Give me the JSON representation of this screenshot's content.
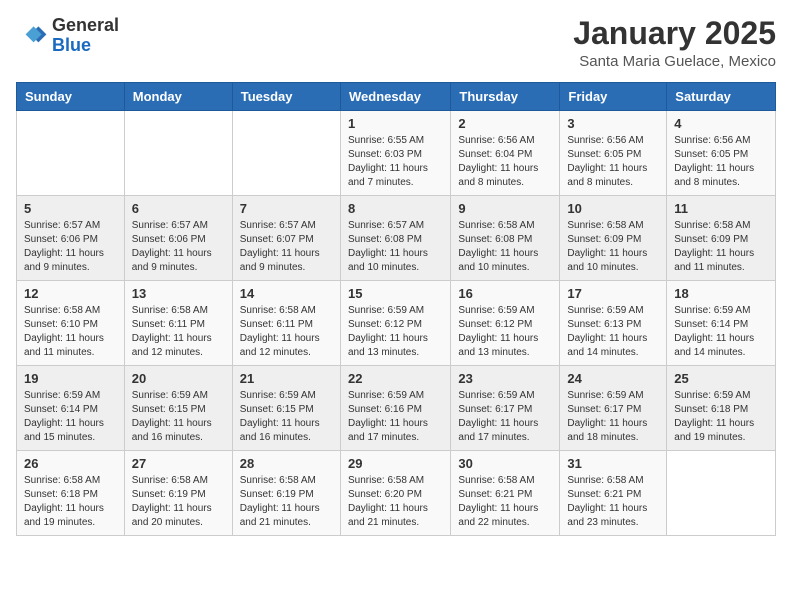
{
  "logo": {
    "general": "General",
    "blue": "Blue"
  },
  "header": {
    "title": "January 2025",
    "subtitle": "Santa Maria Guelace, Mexico"
  },
  "days_of_week": [
    "Sunday",
    "Monday",
    "Tuesday",
    "Wednesday",
    "Thursday",
    "Friday",
    "Saturday"
  ],
  "weeks": [
    [
      {
        "day": "",
        "info": ""
      },
      {
        "day": "",
        "info": ""
      },
      {
        "day": "",
        "info": ""
      },
      {
        "day": "1",
        "info": "Sunrise: 6:55 AM\nSunset: 6:03 PM\nDaylight: 11 hours and 7 minutes."
      },
      {
        "day": "2",
        "info": "Sunrise: 6:56 AM\nSunset: 6:04 PM\nDaylight: 11 hours and 8 minutes."
      },
      {
        "day": "3",
        "info": "Sunrise: 6:56 AM\nSunset: 6:05 PM\nDaylight: 11 hours and 8 minutes."
      },
      {
        "day": "4",
        "info": "Sunrise: 6:56 AM\nSunset: 6:05 PM\nDaylight: 11 hours and 8 minutes."
      }
    ],
    [
      {
        "day": "5",
        "info": "Sunrise: 6:57 AM\nSunset: 6:06 PM\nDaylight: 11 hours and 9 minutes."
      },
      {
        "day": "6",
        "info": "Sunrise: 6:57 AM\nSunset: 6:06 PM\nDaylight: 11 hours and 9 minutes."
      },
      {
        "day": "7",
        "info": "Sunrise: 6:57 AM\nSunset: 6:07 PM\nDaylight: 11 hours and 9 minutes."
      },
      {
        "day": "8",
        "info": "Sunrise: 6:57 AM\nSunset: 6:08 PM\nDaylight: 11 hours and 10 minutes."
      },
      {
        "day": "9",
        "info": "Sunrise: 6:58 AM\nSunset: 6:08 PM\nDaylight: 11 hours and 10 minutes."
      },
      {
        "day": "10",
        "info": "Sunrise: 6:58 AM\nSunset: 6:09 PM\nDaylight: 11 hours and 10 minutes."
      },
      {
        "day": "11",
        "info": "Sunrise: 6:58 AM\nSunset: 6:09 PM\nDaylight: 11 hours and 11 minutes."
      }
    ],
    [
      {
        "day": "12",
        "info": "Sunrise: 6:58 AM\nSunset: 6:10 PM\nDaylight: 11 hours and 11 minutes."
      },
      {
        "day": "13",
        "info": "Sunrise: 6:58 AM\nSunset: 6:11 PM\nDaylight: 11 hours and 12 minutes."
      },
      {
        "day": "14",
        "info": "Sunrise: 6:58 AM\nSunset: 6:11 PM\nDaylight: 11 hours and 12 minutes."
      },
      {
        "day": "15",
        "info": "Sunrise: 6:59 AM\nSunset: 6:12 PM\nDaylight: 11 hours and 13 minutes."
      },
      {
        "day": "16",
        "info": "Sunrise: 6:59 AM\nSunset: 6:12 PM\nDaylight: 11 hours and 13 minutes."
      },
      {
        "day": "17",
        "info": "Sunrise: 6:59 AM\nSunset: 6:13 PM\nDaylight: 11 hours and 14 minutes."
      },
      {
        "day": "18",
        "info": "Sunrise: 6:59 AM\nSunset: 6:14 PM\nDaylight: 11 hours and 14 minutes."
      }
    ],
    [
      {
        "day": "19",
        "info": "Sunrise: 6:59 AM\nSunset: 6:14 PM\nDaylight: 11 hours and 15 minutes."
      },
      {
        "day": "20",
        "info": "Sunrise: 6:59 AM\nSunset: 6:15 PM\nDaylight: 11 hours and 16 minutes."
      },
      {
        "day": "21",
        "info": "Sunrise: 6:59 AM\nSunset: 6:15 PM\nDaylight: 11 hours and 16 minutes."
      },
      {
        "day": "22",
        "info": "Sunrise: 6:59 AM\nSunset: 6:16 PM\nDaylight: 11 hours and 17 minutes."
      },
      {
        "day": "23",
        "info": "Sunrise: 6:59 AM\nSunset: 6:17 PM\nDaylight: 11 hours and 17 minutes."
      },
      {
        "day": "24",
        "info": "Sunrise: 6:59 AM\nSunset: 6:17 PM\nDaylight: 11 hours and 18 minutes."
      },
      {
        "day": "25",
        "info": "Sunrise: 6:59 AM\nSunset: 6:18 PM\nDaylight: 11 hours and 19 minutes."
      }
    ],
    [
      {
        "day": "26",
        "info": "Sunrise: 6:58 AM\nSunset: 6:18 PM\nDaylight: 11 hours and 19 minutes."
      },
      {
        "day": "27",
        "info": "Sunrise: 6:58 AM\nSunset: 6:19 PM\nDaylight: 11 hours and 20 minutes."
      },
      {
        "day": "28",
        "info": "Sunrise: 6:58 AM\nSunset: 6:19 PM\nDaylight: 11 hours and 21 minutes."
      },
      {
        "day": "29",
        "info": "Sunrise: 6:58 AM\nSunset: 6:20 PM\nDaylight: 11 hours and 21 minutes."
      },
      {
        "day": "30",
        "info": "Sunrise: 6:58 AM\nSunset: 6:21 PM\nDaylight: 11 hours and 22 minutes."
      },
      {
        "day": "31",
        "info": "Sunrise: 6:58 AM\nSunset: 6:21 PM\nDaylight: 11 hours and 23 minutes."
      },
      {
        "day": "",
        "info": ""
      }
    ]
  ]
}
